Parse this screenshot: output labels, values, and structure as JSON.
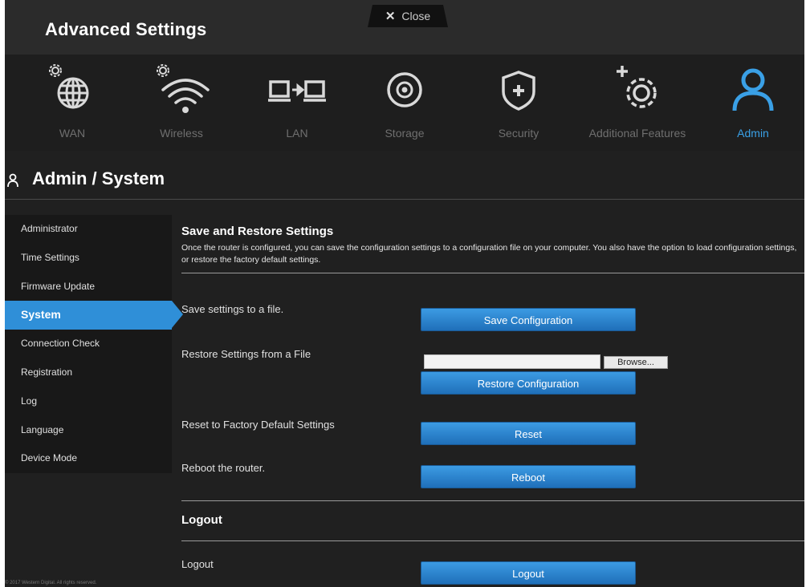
{
  "app": {
    "title": "Advanced Settings",
    "close_label": "Close"
  },
  "nav": {
    "items": [
      {
        "label": "WAN",
        "icon": "globe-gear-icon"
      },
      {
        "label": "Wireless",
        "icon": "wifi-gear-icon"
      },
      {
        "label": "LAN",
        "icon": "lan-computers-icon"
      },
      {
        "label": "Storage",
        "icon": "storage-disc-icon"
      },
      {
        "label": "Security",
        "icon": "shield-plus-icon"
      },
      {
        "label": "Additional Features",
        "icon": "gear-plus-icon"
      },
      {
        "label": "Admin",
        "icon": "user-icon"
      }
    ],
    "active": "Admin"
  },
  "page": {
    "title": "Admin / System"
  },
  "sidebar": {
    "items": [
      {
        "label": "Administrator"
      },
      {
        "label": "Time Settings"
      },
      {
        "label": "Firmware Update"
      },
      {
        "label": "System"
      },
      {
        "label": "Connection Check"
      },
      {
        "label": "Registration"
      },
      {
        "label": "Log"
      },
      {
        "label": "Language"
      },
      {
        "label": "Device Mode"
      }
    ],
    "active": "System"
  },
  "save_restore": {
    "title": "Save and Restore Settings",
    "description": "Once the router is configured, you can save the configuration settings to a configuration file on your computer. You also have the option to load configuration settings, or restore the factory default settings.",
    "save_label": "Save settings to a file.",
    "save_button": "Save Configuration",
    "restore_label": "Restore Settings from a File",
    "browse_button": "Browse...",
    "file_value": "",
    "restore_button": "Restore Configuration",
    "reset_label": "Reset to Factory Default Settings",
    "reset_button": "Reset",
    "reboot_label": "Reboot the router.",
    "reboot_button": "Reboot"
  },
  "logout": {
    "title": "Logout",
    "label": "Logout",
    "button": "Logout"
  },
  "footer": {
    "copyright": "© 2017 Western Digital. All rights reserved."
  },
  "colors": {
    "accent": "#2f8fd8",
    "background": "#202020",
    "nav_inactive": "#6f6f6f",
    "active_icon": "#3aa0e6"
  }
}
